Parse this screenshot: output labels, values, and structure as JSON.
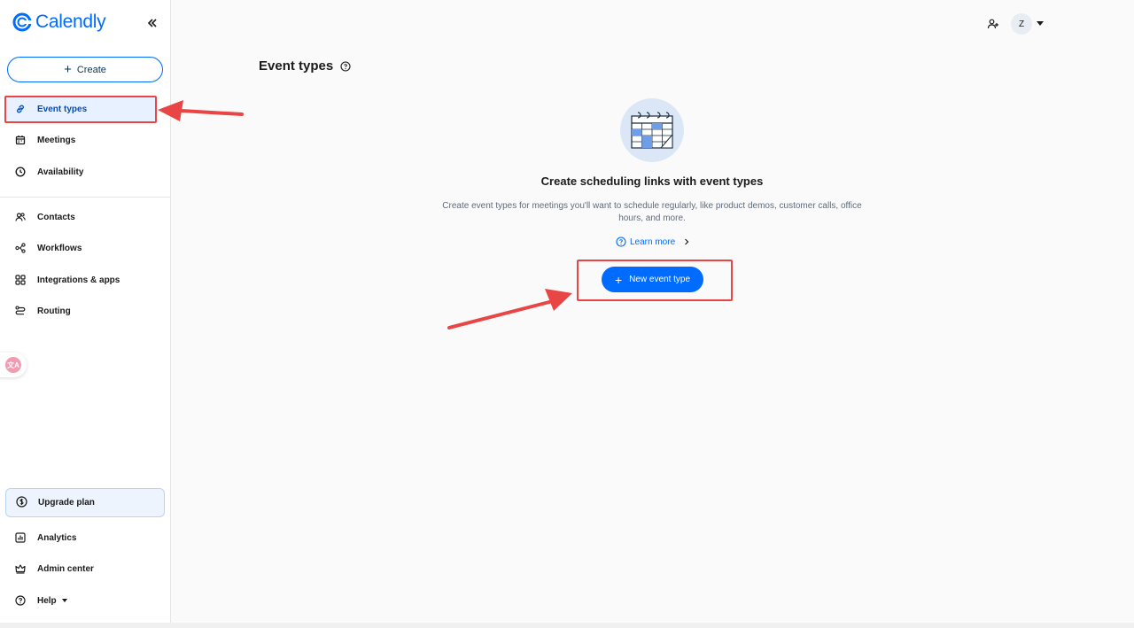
{
  "brand": {
    "name": "Calendly",
    "color": "#006bff"
  },
  "sidebar": {
    "create_label": "Create",
    "items": [
      {
        "label": "Event types",
        "icon": "link-icon",
        "active": true
      },
      {
        "label": "Meetings",
        "icon": "calendar-icon"
      },
      {
        "label": "Availability",
        "icon": "clock-icon"
      },
      {
        "label": "Contacts",
        "icon": "contacts-icon"
      },
      {
        "label": "Workflows",
        "icon": "workflows-icon"
      },
      {
        "label": "Integrations & apps",
        "icon": "apps-grid-icon"
      },
      {
        "label": "Routing",
        "icon": "routing-icon"
      }
    ],
    "upgrade_label": "Upgrade plan",
    "bottom_items": [
      {
        "label": "Analytics",
        "icon": "analytics-icon"
      },
      {
        "label": "Admin center",
        "icon": "crown-icon"
      },
      {
        "label": "Help",
        "icon": "help-icon"
      }
    ]
  },
  "header": {
    "avatar_initial": "Z"
  },
  "main": {
    "title": "Event types",
    "empty_state": {
      "title": "Create scheduling links with event types",
      "description": "Create event types for meetings you'll want to schedule regularly, like product demos, customer calls, office hours, and more.",
      "learn_more": "Learn more",
      "cta": "New event type"
    }
  },
  "colors": {
    "accent": "#006bff",
    "annotation": "#e94545",
    "active_bg": "#e8f1ff"
  }
}
